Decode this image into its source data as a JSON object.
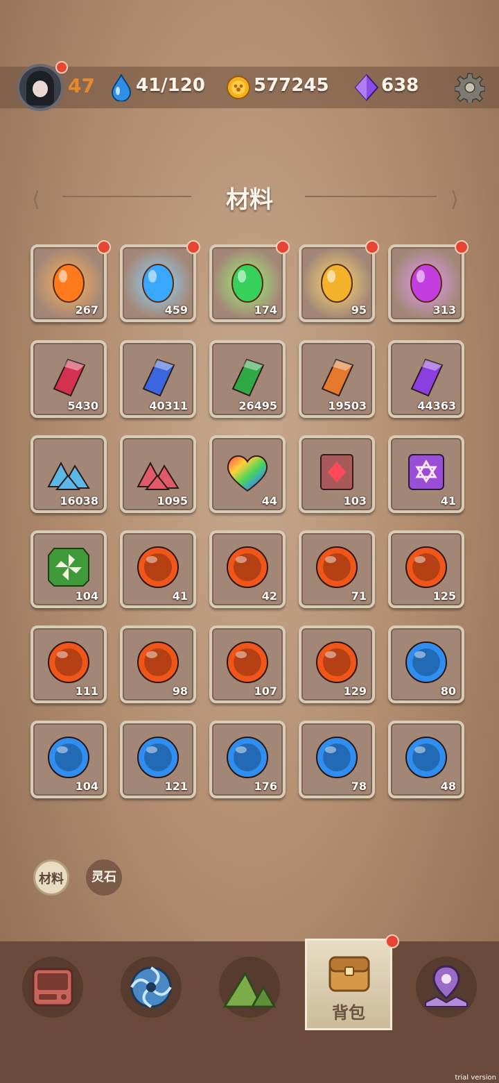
{
  "header": {
    "level": "47",
    "energy": "41/120",
    "coins": "577245",
    "gems": "638"
  },
  "title": "材料",
  "items": [
    {
      "count": "267",
      "kind": "egg",
      "color": "#ff7a1a",
      "glow": "#ffb35c",
      "dot": true
    },
    {
      "count": "459",
      "kind": "egg",
      "color": "#3aa7ff",
      "glow": "#8fd6ff",
      "dot": true
    },
    {
      "count": "174",
      "kind": "egg",
      "color": "#37d05a",
      "glow": "#9cf27a",
      "dot": true
    },
    {
      "count": "95",
      "kind": "egg",
      "color": "#f2b22a",
      "glow": "#ffd970",
      "dot": true
    },
    {
      "count": "313",
      "kind": "egg",
      "color": "#c23ee0",
      "glow": "#e39af5",
      "dot": true
    },
    {
      "count": "5430",
      "kind": "crystal",
      "color": "#d4304f"
    },
    {
      "count": "40311",
      "kind": "crystal",
      "color": "#3a66e0"
    },
    {
      "count": "26495",
      "kind": "crystal",
      "color": "#2fa845"
    },
    {
      "count": "19503",
      "kind": "crystal",
      "color": "#e5782a"
    },
    {
      "count": "44363",
      "kind": "crystal",
      "color": "#8b3fe0"
    },
    {
      "count": "16038",
      "kind": "ore",
      "color": "#5bb8e8"
    },
    {
      "count": "1095",
      "kind": "ore",
      "color": "#e05a6a"
    },
    {
      "count": "44",
      "kind": "heart",
      "color": "#ff5a5a"
    },
    {
      "count": "103",
      "kind": "book",
      "color": "#a85a5a"
    },
    {
      "count": "41",
      "kind": "star",
      "color": "#9a4ed6"
    },
    {
      "count": "104",
      "kind": "fan",
      "color": "#3f9a3a"
    },
    {
      "count": "41",
      "kind": "orb",
      "color": "#f0561a"
    },
    {
      "count": "42",
      "kind": "orb",
      "color": "#f0561a"
    },
    {
      "count": "71",
      "kind": "orb",
      "color": "#f0561a"
    },
    {
      "count": "125",
      "kind": "orb",
      "color": "#f0561a"
    },
    {
      "count": "111",
      "kind": "orb",
      "color": "#f0561a"
    },
    {
      "count": "98",
      "kind": "orb",
      "color": "#f0561a"
    },
    {
      "count": "107",
      "kind": "orb",
      "color": "#f0561a"
    },
    {
      "count": "129",
      "kind": "orb",
      "color": "#f0561a"
    },
    {
      "count": "80",
      "kind": "orb",
      "color": "#2f8ef0"
    },
    {
      "count": "104",
      "kind": "orb",
      "color": "#2f8ef0"
    },
    {
      "count": "121",
      "kind": "orb",
      "color": "#2f8ef0"
    },
    {
      "count": "176",
      "kind": "orb",
      "color": "#2f8ef0"
    },
    {
      "count": "78",
      "kind": "orb",
      "color": "#2f8ef0"
    },
    {
      "count": "48",
      "kind": "orb",
      "color": "#2f8ef0"
    }
  ],
  "filters": [
    {
      "label": "材料",
      "selected": true
    },
    {
      "label": "灵石",
      "selected": false
    }
  ],
  "nav": {
    "selected_label": "背包",
    "icons": [
      "terminal-icon",
      "portal-icon",
      "mountain-icon",
      "backpack-icon",
      "map-pin-icon"
    ]
  },
  "watermark": "trial version"
}
